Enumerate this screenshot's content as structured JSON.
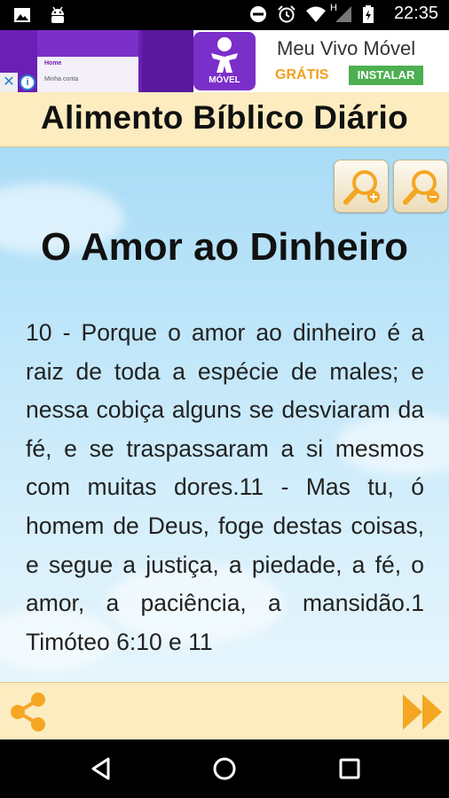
{
  "status_bar": {
    "time": "22:35",
    "network_letter": "H",
    "left_icons": [
      "image-icon",
      "android-icon"
    ],
    "right_icons": [
      "do-not-disturb-icon",
      "alarm-icon",
      "wifi-icon",
      "signal-icon",
      "battery-icon"
    ]
  },
  "ad": {
    "app_label": "MÓVEL",
    "title": "Meu Vivo Móvel",
    "price": "GRÁTIS",
    "install_label": "INSTALAR",
    "preview_item_1": "Home",
    "preview_item_2": "Minha conta",
    "close_glyph": "✕",
    "info_glyph": "i"
  },
  "header": {
    "title": "Alimento Bíblico Diário"
  },
  "verse": {
    "title": "O Amor ao Dinheiro",
    "text": "10 - Porque o amor ao dinheiro é a raiz de toda a espécie de males; e nessa cobiça alguns se desviaram da fé, e se traspassaram a si mesmos com muitas dores.11 - Mas tu, ó homem de Deus, foge destas coisas, e segue a justiça, a piedade, a fé, o amor, a paciência, a mansidão.1 Timóteo 6:10 e 11"
  },
  "colors": {
    "header_bg": "#fcecc0",
    "accent_orange": "#f5a623",
    "ad_purple": "#7b2fc9",
    "install_green": "#4caf50"
  }
}
